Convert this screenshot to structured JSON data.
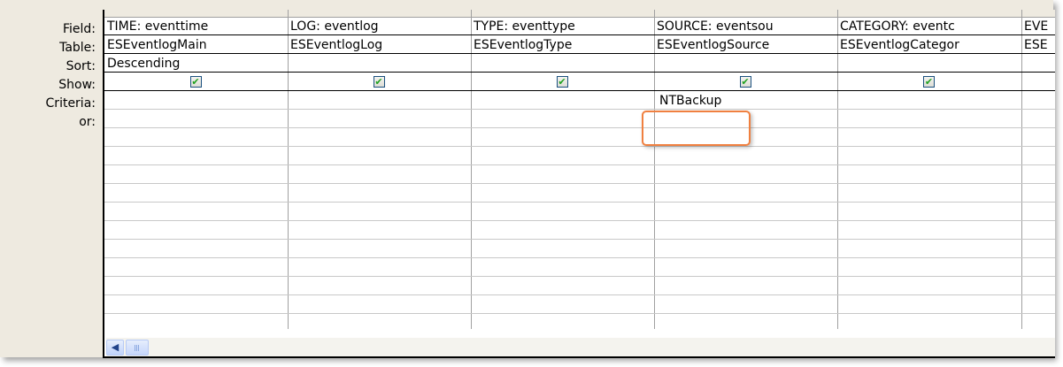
{
  "row_labels": {
    "field": "Field:",
    "table": "Table:",
    "sort": "Sort:",
    "show": "Show:",
    "criteria": "Criteria:",
    "or": "or:"
  },
  "columns": [
    {
      "field": "TIME: eventtime",
      "table": "ESEventlogMain",
      "sort": "Descending",
      "show": true,
      "criteria": ""
    },
    {
      "field": "LOG: eventlog",
      "table": "ESEventlogLog",
      "sort": "",
      "show": true,
      "criteria": ""
    },
    {
      "field": "TYPE: eventtype",
      "table": "ESEventlogType",
      "sort": "",
      "show": true,
      "criteria": ""
    },
    {
      "field": "SOURCE: eventsou",
      "table": "ESEventlogSource",
      "sort": "",
      "show": true,
      "criteria": "NTBackup"
    },
    {
      "field": "CATEGORY: eventc",
      "table": "ESEventlogCategor",
      "sort": "",
      "show": true,
      "criteria": ""
    },
    {
      "field": "EVE",
      "table": "ESE",
      "sort": "",
      "show": false,
      "criteria": ""
    }
  ],
  "show_check_glyph": "✔",
  "scrollbar": {
    "left_arrow_icon": "scroll-left-arrow"
  },
  "colors": {
    "highlight": "#f08040",
    "check": "#21a121",
    "background": "#eeeae0"
  }
}
